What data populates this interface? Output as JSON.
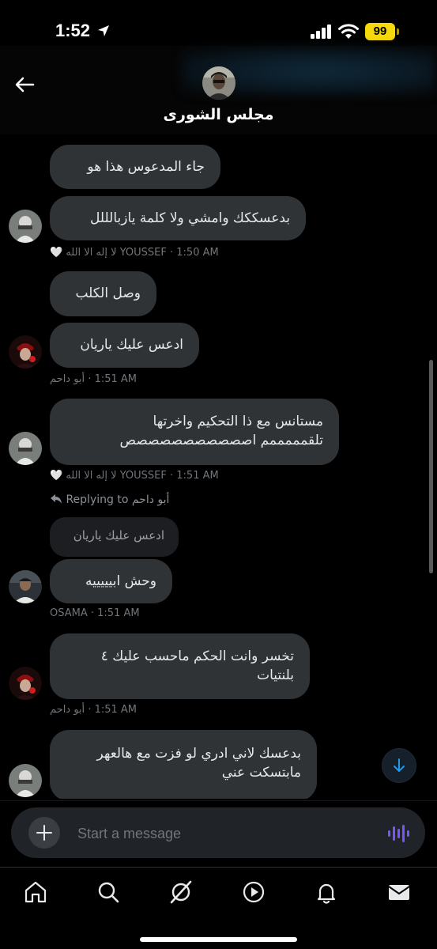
{
  "status_bar": {
    "time": "1:52",
    "battery": "99",
    "battery_color": "#f5d90a",
    "icons": [
      "location-arrow-icon",
      "signal-bars-icon",
      "wifi-icon"
    ]
  },
  "header": {
    "back_icon": "back-arrow-icon",
    "title": "مجلس الشورى"
  },
  "messages": [
    {
      "lines": [
        "جاء المدعوس هذا هو"
      ]
    },
    {
      "lines": [
        "بدعسككك وامشي ولا كلمة يازبالللل"
      ],
      "sender": "YOUSSEF لا إله الا الله 🤍",
      "time": "1:50 AM"
    },
    {
      "lines": [
        "وصل الكلب"
      ]
    },
    {
      "lines": [
        "ادعس عليك ياريان"
      ],
      "sender": "أبو داحم",
      "time": "1:51 AM"
    },
    {
      "lines": [
        "مستانس مع ذا التحكيم واخرتها",
        "تلقمممممم اصصصصصصصصصصص"
      ],
      "sender": "YOUSSEF لا إله الا الله 🤍",
      "time": "1:51 AM"
    },
    {
      "reply_label": "Replying to أبو داحم",
      "quoted": "ادعس عليك ياريان",
      "lines": [
        "وحش ابيييييه"
      ],
      "sender": "OSAMA",
      "time": "1:51 AM"
    },
    {
      "lines": [
        "تخسر وانت الحكم ماحسب عليك ٤",
        "بلنتيات"
      ],
      "sender": "أبو داحم",
      "time": "1:51 AM"
    },
    {
      "lines": [
        "بدعسك لاني ادري لو فزت مع هالعهر",
        "مابتسكت عني"
      ]
    }
  ],
  "composer": {
    "placeholder": "Start a message",
    "accent": "#7856ff"
  },
  "nav": [
    "home-icon",
    "search-icon",
    "grok-icon",
    "video-play-icon",
    "notifications-bell-icon",
    "messages-envelope-icon"
  ],
  "colors": {
    "bubble": "#2f3336",
    "scroll_button_arrow": "#1d9bf0"
  }
}
